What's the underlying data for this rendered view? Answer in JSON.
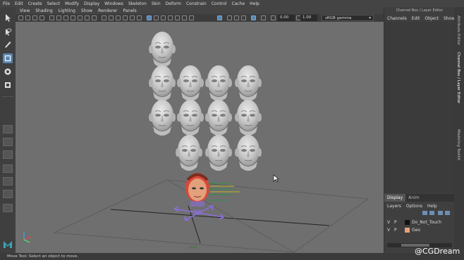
{
  "menubar": [
    "File",
    "Edit",
    "Create",
    "Select",
    "Modify",
    "Display",
    "Windows",
    "Skeleton",
    "Skin",
    "Deform",
    "Constrain",
    "Control",
    "Cache",
    "Help"
  ],
  "viewport": {
    "menu": [
      "View",
      "Shading",
      "Lighting",
      "Show",
      "Renderer",
      "Panels"
    ],
    "exposure_value": "0.00",
    "gamma_value": "1.00",
    "color_space": "sRGB gamma"
  },
  "channel_box": {
    "title": "Channel Box / Layer Editor",
    "tabs": [
      "Channels",
      "Edit",
      "Object",
      "Show"
    ]
  },
  "side_tabs": [
    "Attribute Editor",
    "Channel Box / Layer Editor",
    "Modeling Toolkit"
  ],
  "layer_editor": {
    "tabs": [
      "Display",
      "Anim"
    ],
    "menu": [
      "Layers",
      "Options",
      "Help"
    ],
    "layers": [
      {
        "v": "V",
        "p": "P",
        "color": "#111111",
        "name": "Do_Not_Touch"
      },
      {
        "v": "V",
        "p": "P",
        "color": "#e8a27a",
        "name": "Geo"
      }
    ]
  },
  "helpline": "Move Tool: Select an object to move.",
  "watermark": "@CGDream",
  "colors": {
    "accent": "#5a87b2",
    "viewport_bg": "#6f6f6f",
    "manipulator": "#8a6fd8",
    "rig_head": "#d9493a"
  }
}
